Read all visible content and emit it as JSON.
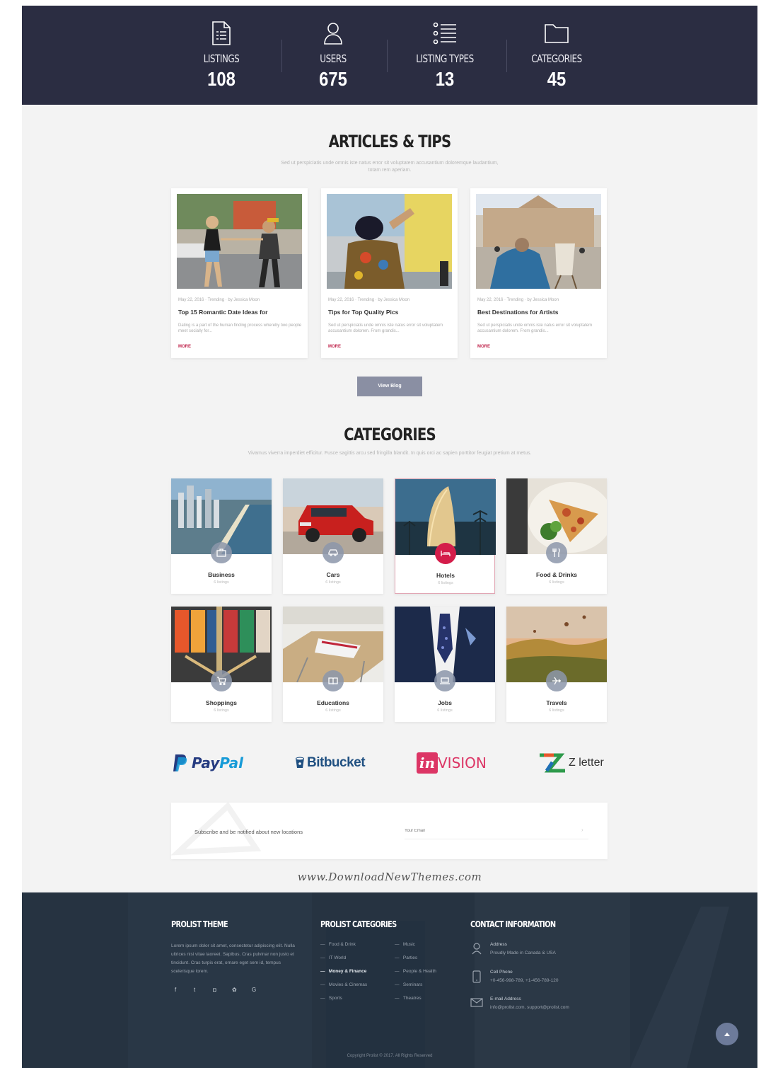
{
  "stats": [
    {
      "label": "LISTINGS",
      "value": "108",
      "icon": "document-list-icon"
    },
    {
      "label": "USERS",
      "value": "675",
      "icon": "user-icon"
    },
    {
      "label": "LISTING TYPES",
      "value": "13",
      "icon": "list-icon"
    },
    {
      "label": "CATEGORIES",
      "value": "45",
      "icon": "folder-icon"
    }
  ],
  "articles": {
    "title": "ARTICLES & TIPS",
    "subtitle": "Sed ut perspiciatis unde omnis iste natus error sit voluptatem accusantium doloremque laudantium, totam rem aperiam.",
    "cards": [
      {
        "meta": "May 22, 2016  ·  Trending  ·  by Jessica Moon",
        "title": "Top 15 Romantic Date Ideas for",
        "excerpt": "Dating is a part of the human finding process whereby two people meet socially for...",
        "more": "MORE"
      },
      {
        "meta": "May 22, 2016  ·  Trending  ·  by Jessica Moon",
        "title": "Tips for Top Quality Pics",
        "excerpt": "Sed ut perspiciatis unde omnis iste natus error sit voluptatem accusantium dolorem. From grandis...",
        "more": "MORE"
      },
      {
        "meta": "May 22, 2016  ·  Trending  ·  by Jessica Moon",
        "title": "Best Destinations for Artists",
        "excerpt": "Sed ut perspiciatis unde omnis iste natus error sit voluptatem accusantium dolorem. From grandis...",
        "more": "MORE"
      }
    ],
    "button": "View Blog"
  },
  "categories": {
    "title": "CATEGORIES",
    "subtitle": "Vivamus viverra imperdiet efficitur. Fusce sagittis arcu sed fringilla blandit. In quis orci ac sapien porttitor feugiat pretium at metus.",
    "items": [
      {
        "name": "Business",
        "count": "6 listings",
        "icon": "briefcase-icon"
      },
      {
        "name": "Cars",
        "count": "6 listings",
        "icon": "car-icon"
      },
      {
        "name": "Hotels",
        "count": "6 listings",
        "icon": "bed-icon"
      },
      {
        "name": "Food & Drinks",
        "count": "6 listings",
        "icon": "cutlery-icon"
      },
      {
        "name": "Shoppings",
        "count": "6 listings",
        "icon": "cart-icon"
      },
      {
        "name": "Educations",
        "count": "6 listings",
        "icon": "book-icon"
      },
      {
        "name": "Jobs",
        "count": "6 listings",
        "icon": "laptop-icon"
      },
      {
        "name": "Travels",
        "count": "6 listings",
        "icon": "plane-icon"
      }
    ]
  },
  "partners": [
    {
      "name_a": "Pay",
      "name_b": "Pal",
      "color_a": "#253b80",
      "color_b": "#179bd7"
    },
    {
      "name": "Bitbucket",
      "color": "#205081"
    },
    {
      "badge": "in",
      "rest": "VISION",
      "color": "#dc3565"
    },
    {
      "name": "Z letter",
      "color": "#333333"
    }
  ],
  "subscribe": {
    "text": "Subscribe and be notified about new locations",
    "placeholder": "Your Email",
    "arrow": "›"
  },
  "watermark": "www.DownloadNewThemes.com",
  "footer": {
    "col1_title": "PROLIST THEME",
    "about": "Lorem ipsum dolor sit amet, consectetur adipiscing elit. Nulla ultrices nisi vitae laoreet. Sapibus. Cras pulvinar non justo et tincidunt. Cras turpis erat, ornare eget sem id, tempus scelerisque lorem.",
    "social": [
      "f",
      "t",
      "◘",
      "✿",
      "G"
    ],
    "col2_title": "PROLIST CATEGORIES",
    "links_a": [
      "Food & Drink",
      "IT World",
      "Money & Finance",
      "Movies & Cinemas",
      "Sports"
    ],
    "links_b": [
      "Music",
      "Parties",
      "People & Health",
      "Seminars",
      "Theatres"
    ],
    "col3_title": "CONTACT INFORMATION",
    "contact": [
      {
        "label": "Address",
        "value": "Proudly Made in Canada & USA",
        "icon": "location-icon"
      },
      {
        "label": "Cell Phone",
        "value": "+0-456-998-789, +1-456-789-120",
        "icon": "phone-icon"
      },
      {
        "label": "E-mail Address",
        "value": "info@prolist.com, support@prolist.com",
        "icon": "mail-icon"
      }
    ],
    "copyright": "Copyright Prolist © 2017. All Rights Reserved"
  },
  "colors": {
    "nav_bg": "#2b2d42",
    "accent": "#d41d4a",
    "footer_bg": "#263341",
    "button": "#8a8fa3"
  }
}
